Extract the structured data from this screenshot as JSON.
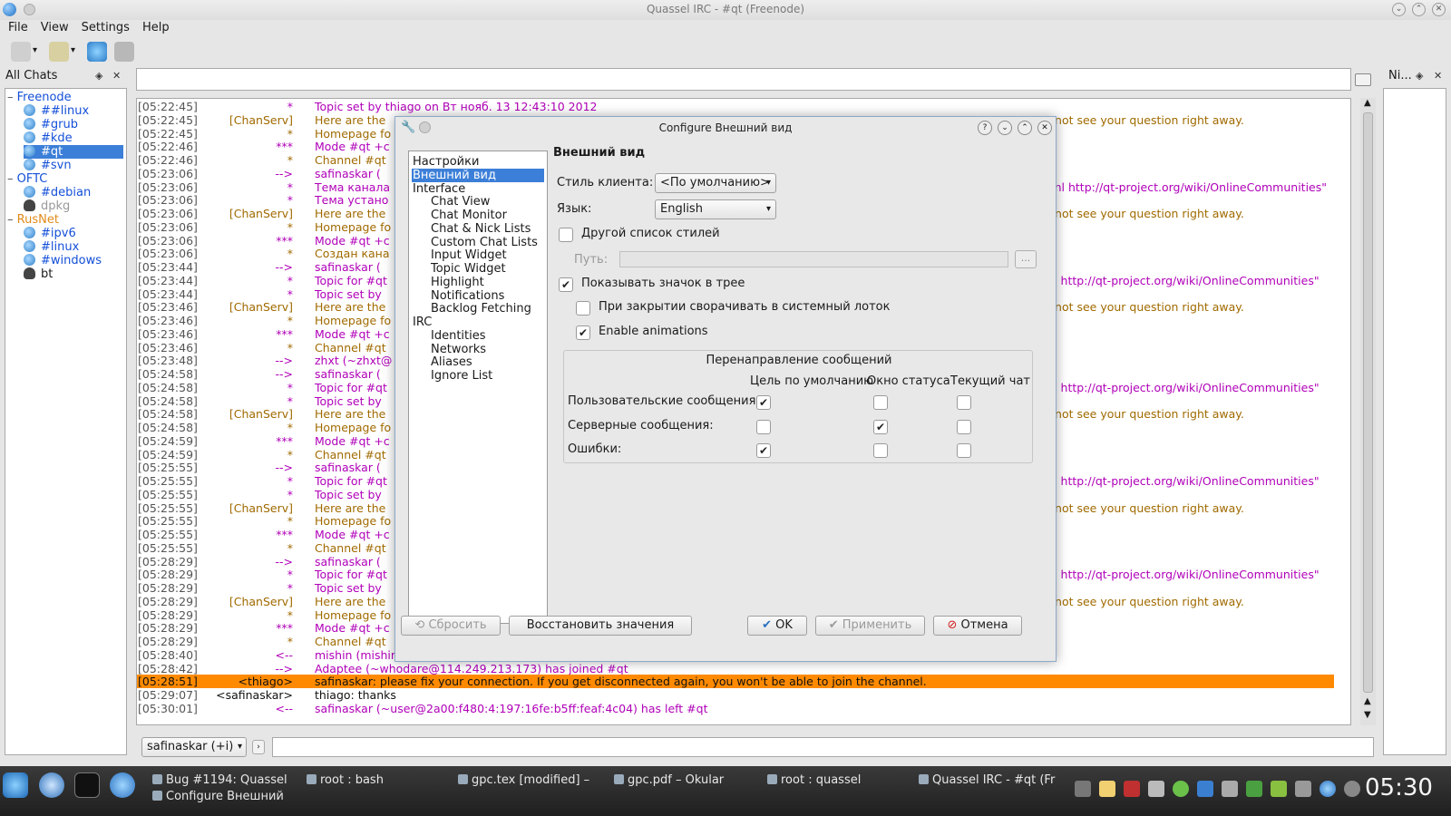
{
  "window": {
    "title": "Quassel IRC - #qt (Freenode)"
  },
  "menu": [
    "File",
    "View",
    "Settings",
    "Help"
  ],
  "chats_panel": {
    "title": "All Chats"
  },
  "nick_panel": {
    "title": "Ni..."
  },
  "networks": [
    {
      "name": "Freenode",
      "color": "#1450d8",
      "channels": [
        {
          "name": "##linux",
          "icon": "channel-icon"
        },
        {
          "name": "#grub",
          "icon": "channel-icon"
        },
        {
          "name": "#kde",
          "icon": "channel-icon"
        },
        {
          "name": "#qt",
          "icon": "channel-icon",
          "selected": true
        },
        {
          "name": "#svn",
          "icon": "channel-icon"
        }
      ]
    },
    {
      "name": "OFTC",
      "color": "#1450d8",
      "channels": [
        {
          "name": "#debian",
          "icon": "channel-icon"
        },
        {
          "name": "dpkg",
          "icon": "user-icon",
          "inactive": true
        }
      ]
    },
    {
      "name": "RusNet",
      "color": "#e08a1a",
      "channels": [
        {
          "name": "#ipv6",
          "icon": "channel-icon"
        },
        {
          "name": "#linux",
          "icon": "channel-icon"
        },
        {
          "name": "#windows",
          "icon": "channel-icon"
        },
        {
          "name": "bt",
          "icon": "user-icon"
        }
      ]
    }
  ],
  "chat_lines": [
    {
      "ts": "[05:22:45]",
      "sender": "*",
      "msg": "Topic set by thiago on Вт нояб. 13 12:43:10 2012",
      "color": "purple"
    },
    {
      "ts": "[05:22:45]",
      "sender": "[ChanServ]",
      "msg": "Here are the",
      "color": "orange"
    },
    {
      "ts": "[05:22:45]",
      "sender": "*",
      "msg": "Homepage fo",
      "color": "orange"
    },
    {
      "ts": "[05:22:46]",
      "sender": "***",
      "msg": "Mode #qt +c",
      "color": "purple"
    },
    {
      "ts": "[05:22:46]",
      "sender": "*",
      "msg": "Channel #qt",
      "color": "orange"
    },
    {
      "ts": "[05:23:06]",
      "sender": "-->",
      "msg": "safinaskar (",
      "color": "purple"
    },
    {
      "ts": "[05:23:06]",
      "sender": "*",
      "msg": "Тема канала",
      "color": "purple"
    },
    {
      "ts": "[05:23:06]",
      "sender": "*",
      "msg": "Тема устано",
      "color": "purple"
    },
    {
      "ts": "[05:23:06]",
      "sender": "[ChanServ]",
      "msg": "Here are the",
      "color": "orange"
    },
    {
      "ts": "[05:23:06]",
      "sender": "*",
      "msg": "Homepage fo",
      "color": "orange"
    },
    {
      "ts": "[05:23:06]",
      "sender": "***",
      "msg": "Mode #qt +c",
      "color": "purple"
    },
    {
      "ts": "[05:23:06]",
      "sender": "*",
      "msg": "Создан кана",
      "color": "orange"
    },
    {
      "ts": "[05:23:44]",
      "sender": "-->",
      "msg": "safinaskar (",
      "color": "purple"
    },
    {
      "ts": "[05:23:44]",
      "sender": "*",
      "msg": "Topic for #qt",
      "color": "purple"
    },
    {
      "ts": "[05:23:44]",
      "sender": "*",
      "msg": "Topic set by",
      "color": "purple"
    },
    {
      "ts": "[05:23:46]",
      "sender": "[ChanServ]",
      "msg": "Here are the",
      "color": "orange"
    },
    {
      "ts": "[05:23:46]",
      "sender": "*",
      "msg": "Homepage fo",
      "color": "orange"
    },
    {
      "ts": "[05:23:46]",
      "sender": "***",
      "msg": "Mode #qt +c",
      "color": "purple"
    },
    {
      "ts": "[05:23:46]",
      "sender": "*",
      "msg": "Channel #qt",
      "color": "orange"
    },
    {
      "ts": "[05:23:48]",
      "sender": "-->",
      "msg": "zhxt (~zhxt@",
      "color": "purple"
    },
    {
      "ts": "[05:24:58]",
      "sender": "-->",
      "msg": "safinaskar (",
      "color": "purple"
    },
    {
      "ts": "[05:24:58]",
      "sender": "*",
      "msg": "Topic for #qt",
      "color": "purple"
    },
    {
      "ts": "[05:24:58]",
      "sender": "*",
      "msg": "Topic set by",
      "color": "purple"
    },
    {
      "ts": "[05:24:58]",
      "sender": "[ChanServ]",
      "msg": "Here are the",
      "color": "orange"
    },
    {
      "ts": "[05:24:58]",
      "sender": "*",
      "msg": "Homepage fo",
      "color": "orange"
    },
    {
      "ts": "[05:24:59]",
      "sender": "***",
      "msg": "Mode #qt +c",
      "color": "purple"
    },
    {
      "ts": "[05:24:59]",
      "sender": "*",
      "msg": "Channel #qt",
      "color": "orange"
    },
    {
      "ts": "[05:25:55]",
      "sender": "-->",
      "msg": "safinaskar (",
      "color": "purple"
    },
    {
      "ts": "[05:25:55]",
      "sender": "*",
      "msg": "Topic for #qt",
      "color": "purple"
    },
    {
      "ts": "[05:25:55]",
      "sender": "*",
      "msg": "Topic set by",
      "color": "purple"
    },
    {
      "ts": "[05:25:55]",
      "sender": "[ChanServ]",
      "msg": "Here are the",
      "color": "orange"
    },
    {
      "ts": "[05:25:55]",
      "sender": "*",
      "msg": "Homepage fo",
      "color": "orange"
    },
    {
      "ts": "[05:25:55]",
      "sender": "***",
      "msg": "Mode #qt +c",
      "color": "purple"
    },
    {
      "ts": "[05:25:55]",
      "sender": "*",
      "msg": "Channel #qt",
      "color": "orange"
    },
    {
      "ts": "[05:28:29]",
      "sender": "-->",
      "msg": "safinaskar (",
      "color": "purple"
    },
    {
      "ts": "[05:28:29]",
      "sender": "*",
      "msg": "Topic for #qt",
      "color": "purple"
    },
    {
      "ts": "[05:28:29]",
      "sender": "*",
      "msg": "Topic set by",
      "color": "purple"
    },
    {
      "ts": "[05:28:29]",
      "sender": "[ChanServ]",
      "msg": "Here are the",
      "color": "orange"
    },
    {
      "ts": "[05:28:29]",
      "sender": "*",
      "msg": "Homepage fo",
      "color": "orange"
    },
    {
      "ts": "[05:28:29]",
      "sender": "***",
      "msg": "Mode #qt +c",
      "color": "purple"
    },
    {
      "ts": "[05:28:29]",
      "sender": "*",
      "msg": "Channel #qt",
      "color": "orange"
    },
    {
      "ts": "[05:28:40]",
      "sender": "<--",
      "msg": "mishin (mishin@nat/redhat/x-xgalgvctspotgkjn) has quit (Ping timeout: 244 seconds)",
      "color": "purple"
    },
    {
      "ts": "[05:28:42]",
      "sender": "-->",
      "msg": "Adaptee (~whodare@114.249.213.173) has joined #qt",
      "color": "purple"
    },
    {
      "ts": "[05:28:51]",
      "sender": "<thiago>",
      "msg": "safinaskar: please fix your connection. If you get disconnected again, you won't be able to join the channel.",
      "color": "plain",
      "highlight": true
    },
    {
      "ts": "[05:29:07]",
      "sender": "<safinaskar>",
      "msg": "thiago: thanks",
      "color": "plain"
    },
    {
      "ts": "[05:30:01]",
      "sender": "<--",
      "msg": "safinaskar (~user@2a00:f480:4:197:16fe:b5ff:feaf:4c04) has left #qt",
      "color": "purple"
    }
  ],
  "right_fragments": [
    {
      "row": 1,
      "text": "ay not see your question right away.",
      "color": "orange"
    },
    {
      "row": 6,
      "text": "t-qml http://qt-project.org/wiki/OnlineCommunities\"",
      "color": "purple"
    },
    {
      "row": 8,
      "text": "ay not see your question right away.",
      "color": "orange"
    },
    {
      "row": 13,
      "text": "qml http://qt-project.org/wiki/OnlineCommunities\"",
      "color": "purple"
    },
    {
      "row": 15,
      "text": "ay not see your question right away.",
      "color": "orange"
    },
    {
      "row": 21,
      "text": "qml http://qt-project.org/wiki/OnlineCommunities\"",
      "color": "purple"
    },
    {
      "row": 23,
      "text": "ay not see your question right away.",
      "color": "orange"
    },
    {
      "row": 28,
      "text": "qml http://qt-project.org/wiki/OnlineCommunities\"",
      "color": "purple"
    },
    {
      "row": 30,
      "text": "ay not see your question right away.",
      "color": "orange"
    },
    {
      "row": 35,
      "text": "qml http://qt-project.org/wiki/OnlineCommunities\"",
      "color": "purple"
    },
    {
      "row": 37,
      "text": "ay not see your question right away.",
      "color": "orange"
    }
  ],
  "input": {
    "nick": "safinaskar (+i)",
    "value": ""
  },
  "dialog": {
    "title": "Configure Внешний вид",
    "tree": [
      {
        "label": "Настройки",
        "level": 0
      },
      {
        "label": "Внешний вид",
        "level": 0,
        "selected": true
      },
      {
        "label": "Interface",
        "level": 0
      },
      {
        "label": "Chat View",
        "level": 1
      },
      {
        "label": "Chat Monitor",
        "level": 1
      },
      {
        "label": "Chat & Nick Lists",
        "level": 1
      },
      {
        "label": "Custom Chat Lists",
        "level": 1
      },
      {
        "label": "Input Widget",
        "level": 1
      },
      {
        "label": "Topic Widget",
        "level": 1
      },
      {
        "label": "Highlight",
        "level": 1
      },
      {
        "label": "Notifications",
        "level": 1
      },
      {
        "label": "Backlog Fetching",
        "level": 1
      },
      {
        "label": "IRC",
        "level": 0
      },
      {
        "label": "Identities",
        "level": 1
      },
      {
        "label": "Networks",
        "level": 1
      },
      {
        "label": "Aliases",
        "level": 1
      },
      {
        "label": "Ignore List",
        "level": 1
      }
    ],
    "form_title": "Внешний вид",
    "client_style_label": "Стиль клиента:",
    "client_style_value": "<По умолчанию>",
    "language_label": "Язык:",
    "language_value": "English",
    "other_stylesheet_label": "Другой список стилей",
    "other_stylesheet_checked": false,
    "path_label": "Путь:",
    "path_value": "",
    "browse_label": "...",
    "show_tray_label": "Показывать значок в трее",
    "show_tray_checked": true,
    "minimize_tray_label": "При закрытии сворачивать в системный лоток",
    "minimize_tray_checked": false,
    "animations_label": "Enable animations",
    "animations_checked": true,
    "redirect": {
      "title": "Перенаправление сообщений",
      "columns": [
        "Цель по умолчанию",
        "Окно статуса",
        "Текущий чат"
      ],
      "rows": [
        {
          "label": "Пользовательские сообщения:",
          "values": [
            true,
            false,
            false
          ]
        },
        {
          "label": "Серверные сообщения:",
          "values": [
            false,
            true,
            false
          ]
        },
        {
          "label": "Ошибки:",
          "values": [
            true,
            false,
            false
          ]
        }
      ]
    },
    "buttons": {
      "reset": "Сбросить",
      "restore": "Восстановить значения",
      "ok": "OK",
      "apply": "Применить",
      "cancel": "Отмена"
    }
  },
  "taskbar": {
    "tasks": [
      {
        "label": "Bug #1194: Quassel"
      },
      {
        "label": "root : bash"
      },
      {
        "label": "gpc.tex [modified] –"
      },
      {
        "label": "gpc.pdf – Okular"
      },
      {
        "label": "root : quassel"
      },
      {
        "label": "Quassel IRC - #qt (Fr"
      },
      {
        "label": "Configure Внешний"
      }
    ],
    "clock": "05:30"
  },
  "colors": {
    "purple": "#b000b8",
    "orange": "#a06a00",
    "link": "#1450a8",
    "highlight": "#ff8a00",
    "selection": "#3c7fd8"
  }
}
